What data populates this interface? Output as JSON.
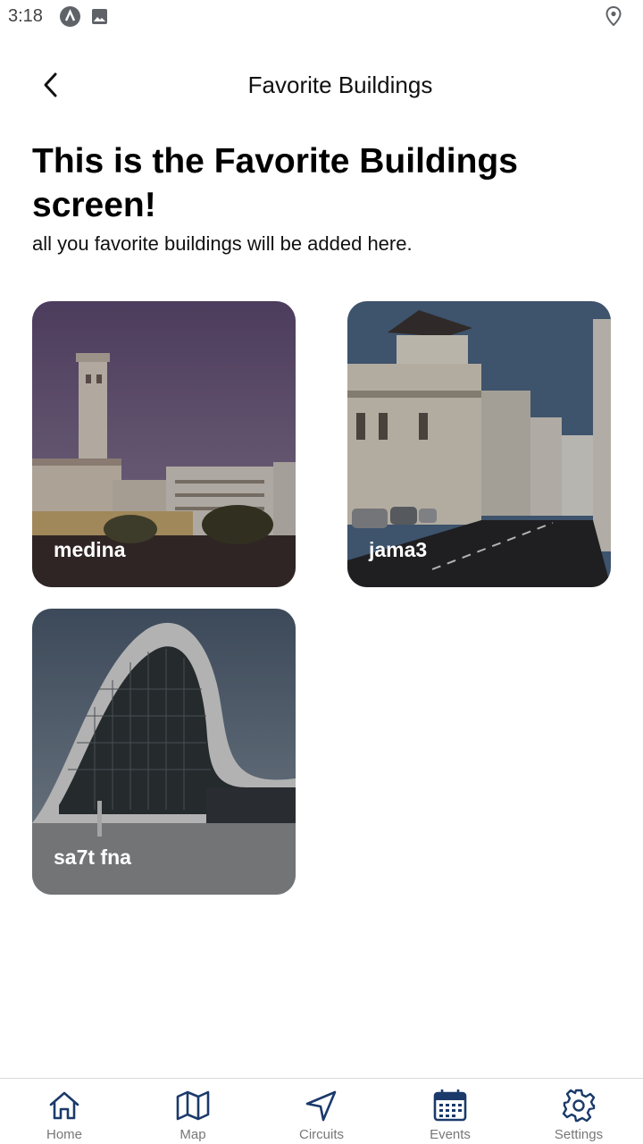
{
  "status_bar": {
    "time": "3:18",
    "icons": [
      "app-a-icon",
      "image-icon",
      "location-pin-icon"
    ]
  },
  "app_bar": {
    "title": "Favorite Buildings",
    "back_icon": "chevron-left-icon"
  },
  "main": {
    "headline": "This is the Favorite Buildings screen!",
    "subtext": "all you favorite buildings will be added here."
  },
  "buildings": [
    {
      "name": "medina"
    },
    {
      "name": "jama3"
    },
    {
      "name": "sa7t fna"
    }
  ],
  "bottom_nav": {
    "items": [
      {
        "label": "Home",
        "icon": "home-icon"
      },
      {
        "label": "Map",
        "icon": "map-icon"
      },
      {
        "label": "Circuits",
        "icon": "navigation-arrow-icon"
      },
      {
        "label": "Events",
        "icon": "calendar-icon"
      },
      {
        "label": "Settings",
        "icon": "gear-icon"
      }
    ]
  },
  "colors": {
    "nav_icon": "#1b3a6b",
    "nav_label": "#777777"
  }
}
